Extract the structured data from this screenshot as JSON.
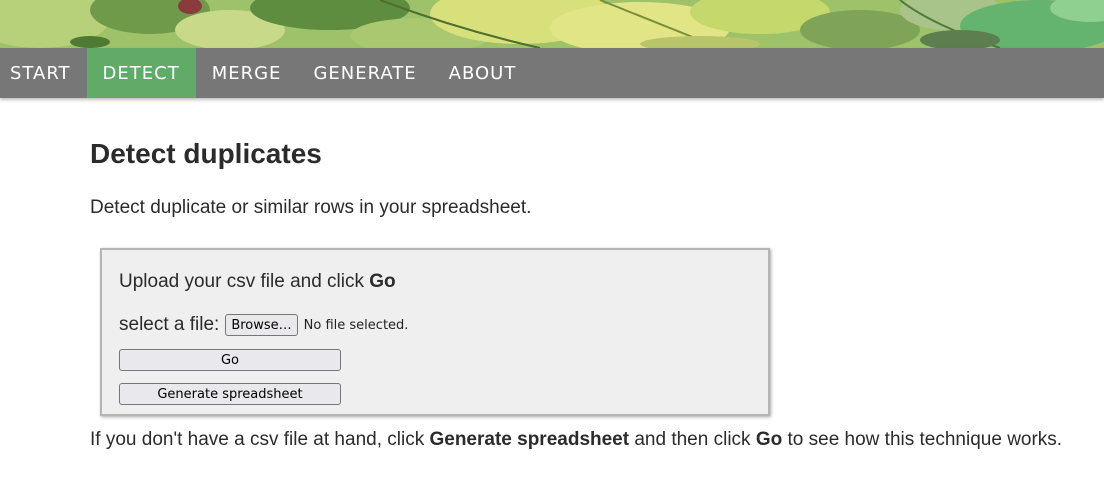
{
  "nav": {
    "items": [
      {
        "label": "START"
      },
      {
        "label": "DETECT"
      },
      {
        "label": "MERGE"
      },
      {
        "label": "GENERATE"
      },
      {
        "label": "ABOUT"
      }
    ],
    "active_index": 1,
    "active_color": "#5fab67",
    "bar_color": "#777777"
  },
  "page": {
    "title": "Detect duplicates",
    "intro": "Detect duplicate or similar rows in your spreadsheet."
  },
  "upload": {
    "heading_text": "Upload your csv file and click ",
    "heading_bold": "Go",
    "file_label": "select a file:",
    "browse_label": "Browse…",
    "file_status": "No file selected.",
    "go_label": "Go",
    "generate_label": "Generate spreadsheet"
  },
  "footer": {
    "part1": "If you don't have a csv file at hand, click ",
    "bold1": "Generate spreadsheet",
    "part2": " and then click ",
    "bold2": "Go",
    "part3": " to see how this technique works."
  }
}
